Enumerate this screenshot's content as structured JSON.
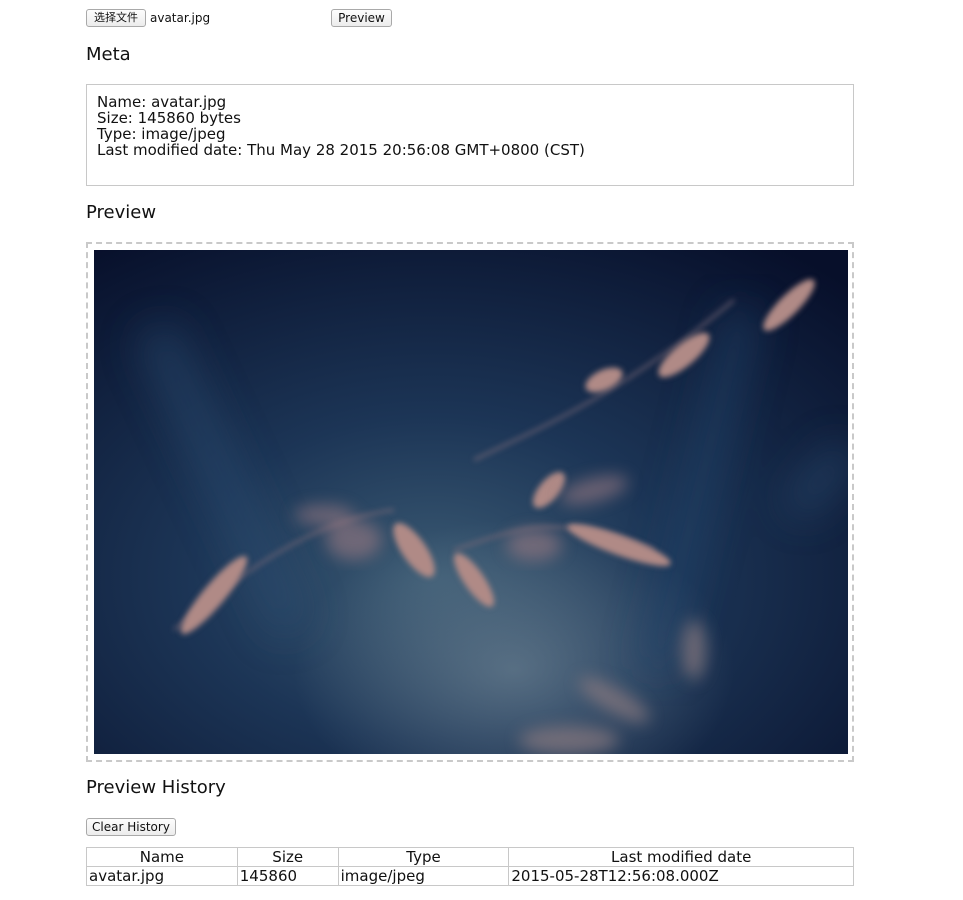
{
  "file_input": {
    "choose_label": "选择文件",
    "file_name": "avatar.jpg",
    "preview_button": "Preview"
  },
  "meta": {
    "heading": "Meta",
    "lines": [
      "Name: avatar.jpg",
      "Size: 145860 bytes",
      "Type: image/jpeg",
      "Last modified date: Thu May 28 2015 20:56:08 GMT+0800 (CST)"
    ]
  },
  "preview": {
    "heading": "Preview"
  },
  "history": {
    "heading": "Preview History",
    "clear_button": "Clear History",
    "columns": [
      "Name",
      "Size",
      "Type",
      "Last modified date"
    ],
    "rows": [
      [
        "avatar.jpg",
        "145860",
        "image/jpeg",
        "2015-05-28T12:56:08.000Z"
      ]
    ]
  },
  "colors": {
    "photo_background": "#0d1c3a",
    "photo_plant": "#b08a86"
  }
}
